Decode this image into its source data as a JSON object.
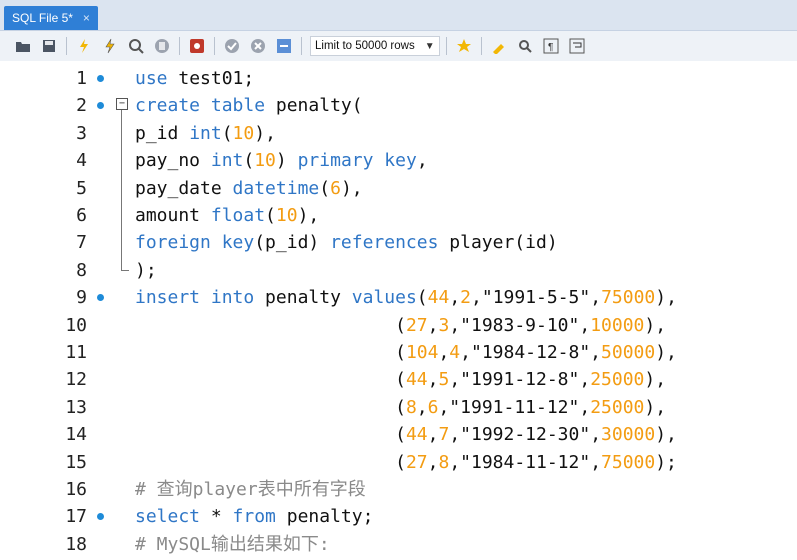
{
  "tab": {
    "title": "SQL File 5*",
    "close": "×"
  },
  "toolbar": {
    "icons": [
      "folder-open-icon",
      "save-icon",
      "execute-icon",
      "execute-current-icon",
      "explain-icon",
      "stop-icon",
      "toggle-errors-icon",
      "commit-icon",
      "rollback-icon",
      "autocommit-icon",
      "beautify-icon",
      "find-icon",
      "invisible-chars-icon",
      "wrap-icon",
      "bookmark-icon"
    ],
    "limit_label": "Limit to 50000 rows"
  },
  "lines": [
    {
      "n": "1",
      "dot": true,
      "code": [
        [
          "kw",
          "use"
        ],
        [
          "t",
          " test01;"
        ]
      ]
    },
    {
      "n": "2",
      "dot": true,
      "fold": "−",
      "code": [
        [
          "kw",
          "create table"
        ],
        [
          "t",
          " penalty("
        ]
      ]
    },
    {
      "n": "3",
      "code": [
        [
          "t",
          "p_id "
        ],
        [
          "kw",
          "int"
        ],
        [
          "t",
          "("
        ],
        [
          "num",
          "10"
        ],
        [
          "t",
          "),"
        ]
      ]
    },
    {
      "n": "4",
      "code": [
        [
          "t",
          "pay_no "
        ],
        [
          "kw",
          "int"
        ],
        [
          "t",
          "("
        ],
        [
          "num",
          "10"
        ],
        [
          "t",
          ") "
        ],
        [
          "kw",
          "primary key"
        ],
        [
          "t",
          ","
        ]
      ]
    },
    {
      "n": "5",
      "code": [
        [
          "t",
          "pay_date "
        ],
        [
          "kw",
          "datetime"
        ],
        [
          "t",
          "("
        ],
        [
          "num",
          "6"
        ],
        [
          "t",
          "),"
        ]
      ]
    },
    {
      "n": "6",
      "code": [
        [
          "t",
          "amount "
        ],
        [
          "kw",
          "float"
        ],
        [
          "t",
          "("
        ],
        [
          "num",
          "10"
        ],
        [
          "t",
          "),"
        ]
      ]
    },
    {
      "n": "7",
      "code": [
        [
          "kw",
          "foreign key"
        ],
        [
          "t",
          "(p_id) "
        ],
        [
          "kw",
          "references"
        ],
        [
          "t",
          " player(id)"
        ]
      ]
    },
    {
      "n": "8",
      "code": [
        [
          "t",
          ");"
        ]
      ]
    },
    {
      "n": "9",
      "dot": true,
      "code": [
        [
          "kw",
          "insert into"
        ],
        [
          "t",
          " penalty "
        ],
        [
          "kw",
          "values"
        ],
        [
          "t",
          "("
        ],
        [
          "num",
          "44"
        ],
        [
          "t",
          ","
        ],
        [
          "num",
          "2"
        ],
        [
          "t",
          ",\"1991-5-5\","
        ],
        [
          "num",
          "75000"
        ],
        [
          "t",
          "),"
        ]
      ]
    },
    {
      "n": "10",
      "code": [
        [
          "t",
          "                        ("
        ],
        [
          "num",
          "27"
        ],
        [
          "t",
          ","
        ],
        [
          "num",
          "3"
        ],
        [
          "t",
          ",\"1983-9-10\","
        ],
        [
          "num",
          "10000"
        ],
        [
          "t",
          "),"
        ]
      ]
    },
    {
      "n": "11",
      "code": [
        [
          "t",
          "                        ("
        ],
        [
          "num",
          "104"
        ],
        [
          "t",
          ","
        ],
        [
          "num",
          "4"
        ],
        [
          "t",
          ",\"1984-12-8\","
        ],
        [
          "num",
          "50000"
        ],
        [
          "t",
          "),"
        ]
      ]
    },
    {
      "n": "12",
      "code": [
        [
          "t",
          "                        ("
        ],
        [
          "num",
          "44"
        ],
        [
          "t",
          ","
        ],
        [
          "num",
          "5"
        ],
        [
          "t",
          ",\"1991-12-8\","
        ],
        [
          "num",
          "25000"
        ],
        [
          "t",
          "),"
        ]
      ]
    },
    {
      "n": "13",
      "code": [
        [
          "t",
          "                        ("
        ],
        [
          "num",
          "8"
        ],
        [
          "t",
          ","
        ],
        [
          "num",
          "6"
        ],
        [
          "t",
          ",\"1991-11-12\","
        ],
        [
          "num",
          "25000"
        ],
        [
          "t",
          "),"
        ]
      ]
    },
    {
      "n": "14",
      "code": [
        [
          "t",
          "                        ("
        ],
        [
          "num",
          "44"
        ],
        [
          "t",
          ","
        ],
        [
          "num",
          "7"
        ],
        [
          "t",
          ",\"1992-12-30\","
        ],
        [
          "num",
          "30000"
        ],
        [
          "t",
          "),"
        ]
      ]
    },
    {
      "n": "15",
      "code": [
        [
          "t",
          "                        ("
        ],
        [
          "num",
          "27"
        ],
        [
          "t",
          ","
        ],
        [
          "num",
          "8"
        ],
        [
          "t",
          ",\"1984-11-12\","
        ],
        [
          "num",
          "75000"
        ],
        [
          "t",
          ");"
        ]
      ]
    },
    {
      "n": "16",
      "code": [
        [
          "cm",
          "# 查询player表中所有字段"
        ]
      ]
    },
    {
      "n": "17",
      "dot": true,
      "code": [
        [
          "kw",
          "select"
        ],
        [
          "t",
          " * "
        ],
        [
          "kw",
          "from"
        ],
        [
          "t",
          " penalty;"
        ]
      ]
    },
    {
      "n": "18",
      "code": [
        [
          "cm",
          "# MySQL输出结果如下:"
        ]
      ]
    }
  ],
  "colors": {
    "keyword": "#2f76c6",
    "number": "#f39c12",
    "comment": "#8a8a8a",
    "tab": "#2f7fd6",
    "dot": "#1e8bd8"
  }
}
